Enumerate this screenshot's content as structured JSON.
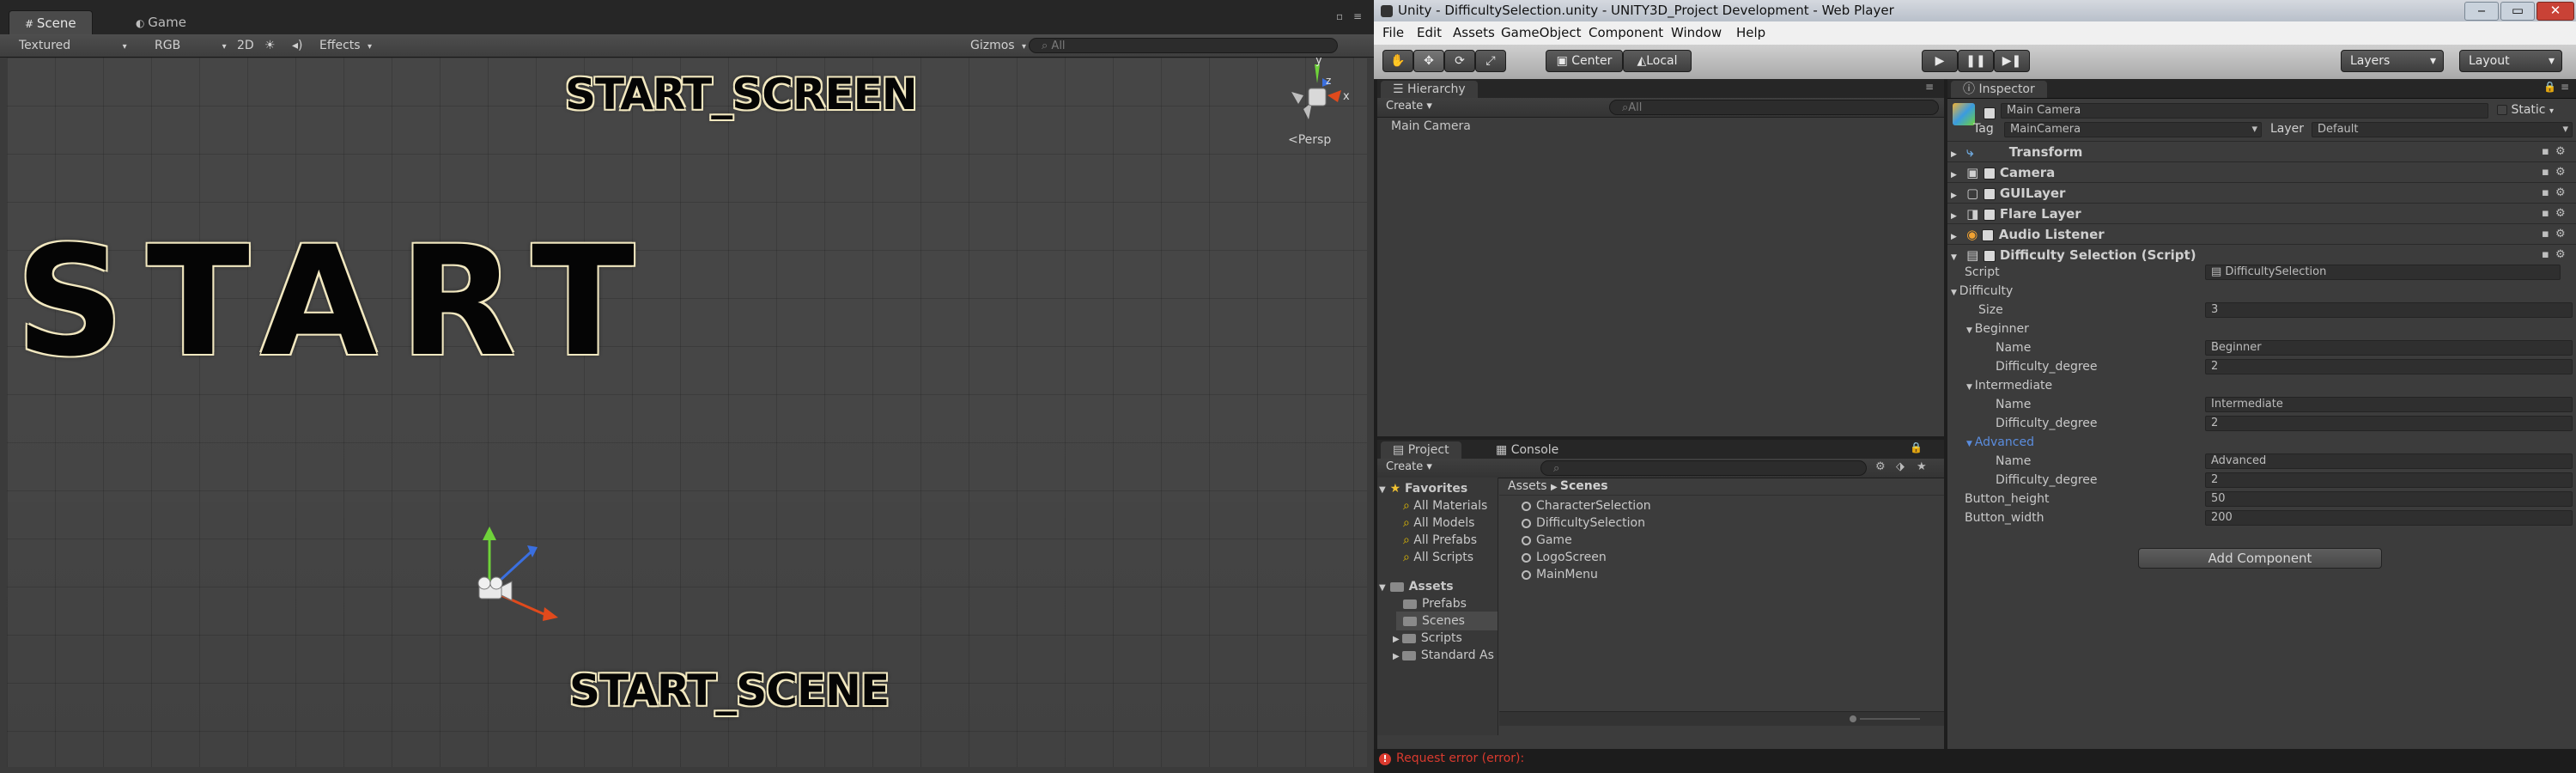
{
  "scene_window": {
    "tabs": [
      {
        "label": "Scene"
      },
      {
        "label": "Game"
      }
    ],
    "toolbar": {
      "shading": "Textured",
      "render": "RGB",
      "mode_2d": "2D",
      "effects": "Effects",
      "gizmos": "Gizmos",
      "search_placeholder": "All"
    },
    "gizmo": {
      "x": "x",
      "y": "y",
      "z": "z",
      "persp": "Persp"
    },
    "objects": {
      "top_label": "START_SCREEN",
      "big_label": "START",
      "bottom_label": "START_SCENE"
    }
  },
  "editor": {
    "title": "Unity - DifficultySelection.unity - UNITY3D_Project Development - Web Player",
    "menu": [
      "File",
      "Edit",
      "Assets",
      "GameObject",
      "Component",
      "Window",
      "Help"
    ],
    "toolbar": {
      "center": "Center",
      "local": "Local",
      "layers": "Layers",
      "layout": "Layout"
    }
  },
  "hierarchy": {
    "tab": "Hierarchy",
    "create": "Create",
    "search_placeholder": "All",
    "items": [
      "Main Camera"
    ]
  },
  "project": {
    "tabs": [
      {
        "label": "Project"
      },
      {
        "label": "Console"
      }
    ],
    "create": "Create",
    "favorites_label": "Favorites",
    "favorites": [
      "All Materials",
      "All Models",
      "All Prefabs",
      "All Scripts"
    ],
    "assets_label": "Assets",
    "folders": [
      "Prefabs",
      "Scenes",
      "Scripts",
      "Standard As"
    ],
    "breadcrumb": {
      "root": "Assets",
      "current": "Scenes"
    },
    "files": [
      "CharacterSelection",
      "DifficultySelection",
      "Game",
      "LogoScreen",
      "MainMenu"
    ]
  },
  "status": {
    "error": "Request error (error):"
  },
  "inspector": {
    "tab": "Inspector",
    "object_name": "Main Camera",
    "static_label": "Static",
    "tag_label": "Tag",
    "tag_value": "MainCamera",
    "layer_label": "Layer",
    "layer_value": "Default",
    "components": [
      "Transform",
      "Camera",
      "GUILayer",
      "Flare Layer",
      "Audio Listener",
      "Difficulty Selection (Script)"
    ],
    "script_label": "Script",
    "script_value": "DifficultySelection",
    "difficulty": {
      "label": "Difficulty",
      "size_label": "Size",
      "size": "3",
      "levels": [
        {
          "header": "Beginner",
          "name_label": "Name",
          "name": "Beginner",
          "degree_label": "Difficulty_degree",
          "degree": "2"
        },
        {
          "header": "Intermediate",
          "name_label": "Name",
          "name": "Intermediate",
          "degree_label": "Difficulty_degree",
          "degree": "2"
        },
        {
          "header": "Advanced",
          "name_label": "Name",
          "name": "Advanced",
          "degree_label": "Difficulty_degree",
          "degree": "2"
        }
      ]
    },
    "button_height_label": "Button_height",
    "button_height": "50",
    "button_width_label": "Button_width",
    "button_width": "200",
    "add_component": "Add Component"
  }
}
